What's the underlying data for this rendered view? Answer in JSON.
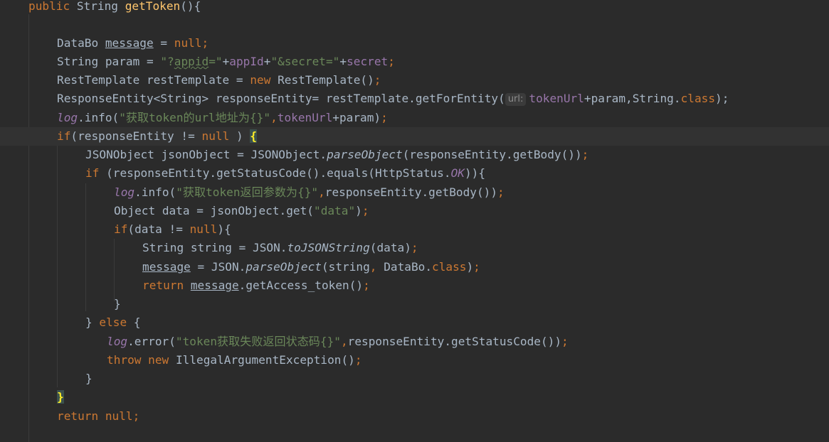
{
  "editor": {
    "theme": "darcula",
    "colors": {
      "background": "#2b2b2b",
      "keyword": "#cc7832",
      "string": "#6a8759",
      "field": "#9876aa",
      "method_decl": "#ffc66d",
      "text": "#a9b7c6"
    },
    "code": {
      "sig_public": "public",
      "sig_type": "String",
      "sig_name": "getToken",
      "sig_rest": "(){",
      "l2_type": "DataBo",
      "l2_var": "message",
      "l2_eq": "=",
      "l2_null": "null;",
      "l3_a": "String param =",
      "l3_s1a": "\"?",
      "l3_s1b": "appid",
      "l3_s1c": "=\"",
      "l3_plus1": "+",
      "l3_appid": "appId",
      "l3_plus2": "+",
      "l3_s2": "\"&secret=\"",
      "l3_plus3": "+",
      "l3_secret": "secret",
      "l3_semi": ";",
      "l4_a": "RestTemplate restTemplate =",
      "l4_new": "new",
      "l4_b": "RestTemplate()",
      "l4_semi": ";",
      "l5_a": "ResponseEntity<String> responseEntity= restTemplate.getForEntity(",
      "l5_hint": "url:",
      "l5_url": "tokenUrl",
      "l5_b": "+param,String.",
      "l5_class": "class",
      "l5_c": ");",
      "l6_log": "log",
      "l6_a": ".info(",
      "l6_str": "\"获取token的url地址为{}\"",
      "l6_comma": ",",
      "l6_url": "tokenUrl",
      "l6_b": "+param)",
      "l6_semi": ";",
      "l7_if": "if",
      "l7_a": "(responseEntity !=",
      "l7_null": "null",
      "l7_b": ")",
      "l7_brace": "{",
      "l8_a": "JSONObject jsonObject = JSONObject.",
      "l8_m": "parseObject",
      "l8_b": "(responseEntity.getBody())",
      "l8_semi": ";",
      "l9_if": "if",
      "l9_a": "(responseEntity.getStatusCode().equals(HttpStatus.",
      "l9_ok": "OK",
      "l9_b": ")){",
      "l10_log": "log",
      "l10_a": ".info(",
      "l10_str": "\"获取token返回参数为{}\"",
      "l10_comma": ",",
      "l10_b": "responseEntity.getBody())",
      "l10_semi": ";",
      "l11_a": "Object data = jsonObject.get(",
      "l11_str": "\"data\"",
      "l11_b": ")",
      "l11_semi": ";",
      "l12_if": "if",
      "l12_a": "(data !=",
      "l12_null": "null",
      "l12_b": "){",
      "l13_a": "String string = JSON.",
      "l13_m": "toJSONString",
      "l13_b": "(data)",
      "l13_semi": ";",
      "l14_var": "message",
      "l14_a": "= JSON.",
      "l14_m": "parseObject",
      "l14_b": "(string",
      "l14_comma": ",",
      "l14_c": "DataBo.",
      "l14_class": "class",
      "l14_d": ")",
      "l14_semi": ";",
      "l15_ret": "return",
      "l15_var": "message",
      "l15_a": ".getAccess_token()",
      "l15_semi": ";",
      "l16_close": "}",
      "l17_close": "}",
      "l17_else": "else",
      "l17_open": "{",
      "l18_log": "log",
      "l18_a": ".error(",
      "l18_str": "\"token获取失败返回状态码{}\"",
      "l18_comma": ",",
      "l18_b": "responseEntity.getStatusCode())",
      "l18_semi": ";",
      "l19_throw": "throw",
      "l19_new": "new",
      "l19_a": "IllegalArgumentException()",
      "l19_semi": ";",
      "l20_close": "}",
      "l21_close": "}",
      "l22_ret": "return",
      "l22_null": "null;"
    }
  }
}
